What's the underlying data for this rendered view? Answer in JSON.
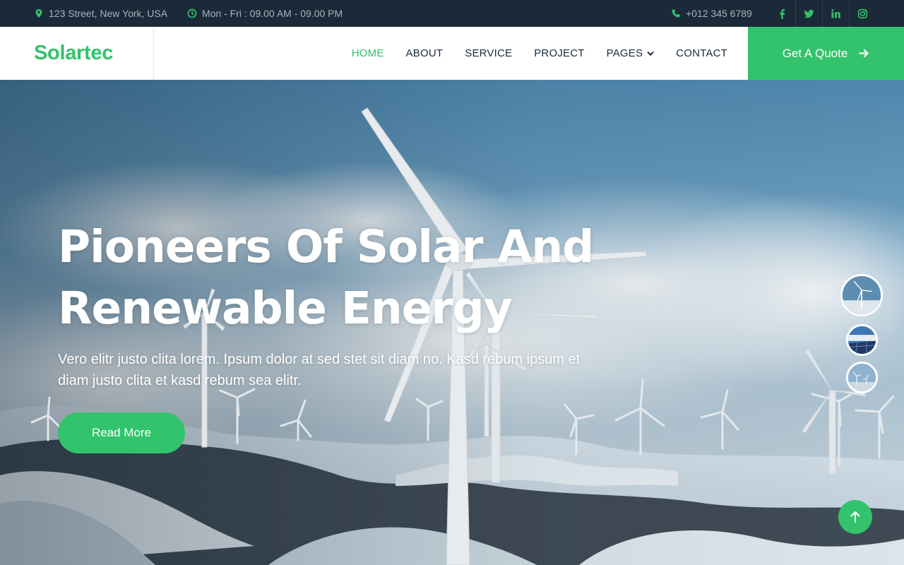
{
  "topbar": {
    "address": "123 Street, New York, USA",
    "hours": "Mon - Fri : 09.00 AM - 09.00 PM",
    "phone": "+012 345 6789",
    "social": [
      {
        "name": "facebook-icon"
      },
      {
        "name": "twitter-icon"
      },
      {
        "name": "linkedin-icon"
      },
      {
        "name": "instagram-icon"
      }
    ]
  },
  "navbar": {
    "brand": "Solartec",
    "menu": [
      {
        "label": "HOME",
        "active": true
      },
      {
        "label": "ABOUT"
      },
      {
        "label": "SERVICE"
      },
      {
        "label": "PROJECT"
      },
      {
        "label": "PAGES",
        "dropdown": true
      },
      {
        "label": "CONTACT"
      }
    ],
    "cta_label": "Get A Quote"
  },
  "hero": {
    "title_line1": "Pioneers Of Solar And",
    "title_line2": "Renewable Energy",
    "subtitle": "Vero elitr justo clita lorem. Ipsum dolor at sed stet sit diam no. Kasd rebum ipsum et diam justo clita et kasd rebum sea elitr.",
    "button_label": "Read More",
    "carousel": {
      "slides": 3,
      "active_index": 0
    }
  },
  "colors": {
    "accent": "#32c36c",
    "dark": "#1b2a38",
    "topbar_text": "#a9b3bd"
  }
}
